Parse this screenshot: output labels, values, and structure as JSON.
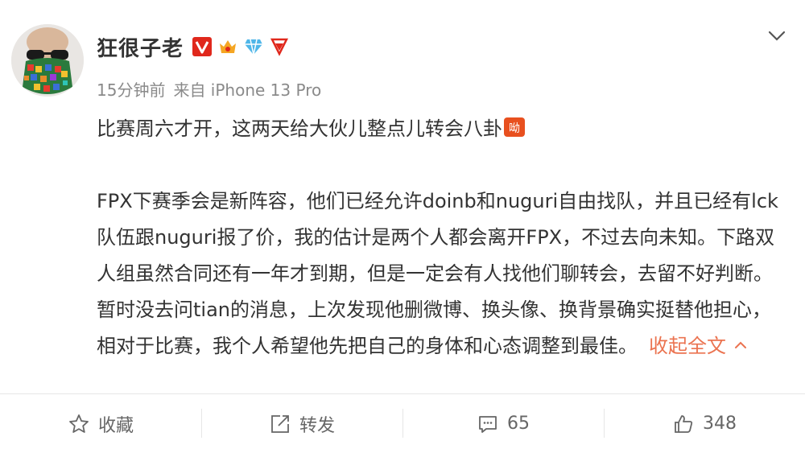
{
  "user": {
    "name": "狂很子老",
    "avatar_icon": "bearded-avatar-icon",
    "badges": [
      "verified-v-icon",
      "vip-crown-icon",
      "diamond-member-icon",
      "lol-fan-icon"
    ]
  },
  "post": {
    "meta_time": "15分钟前",
    "meta_source": "来自 iPhone 13 Pro",
    "line1": "比赛周六才开，这两天给大伙儿整点儿转会八卦",
    "line1_emoji": "gossip-emoji-icon",
    "body": "FPX下赛季会是新阵容，他们已经允许doinb和nuguri自由找队，并且已经有lck队伍跟nuguri报了价，我的估计是两个人都会离开FPX，不过去向未知。下路双人组虽然合同还有一年才到期，但是一定会有人找他们聊转会，去留不好判断。暂时没去问tian的消息，上次发现他删微博、换头像、换背景确实挺替他担心，相对于比赛，我个人希望他先把自己的身体和心态调整到最佳。",
    "collapse_label": "收起全文"
  },
  "actions": {
    "favorite": "收藏",
    "repost": "转发",
    "comments": "65",
    "likes": "348"
  },
  "colors": {
    "accent": "#eb7350",
    "text": "#333333",
    "meta": "#8a8a8a",
    "verified": "#e0281c"
  }
}
